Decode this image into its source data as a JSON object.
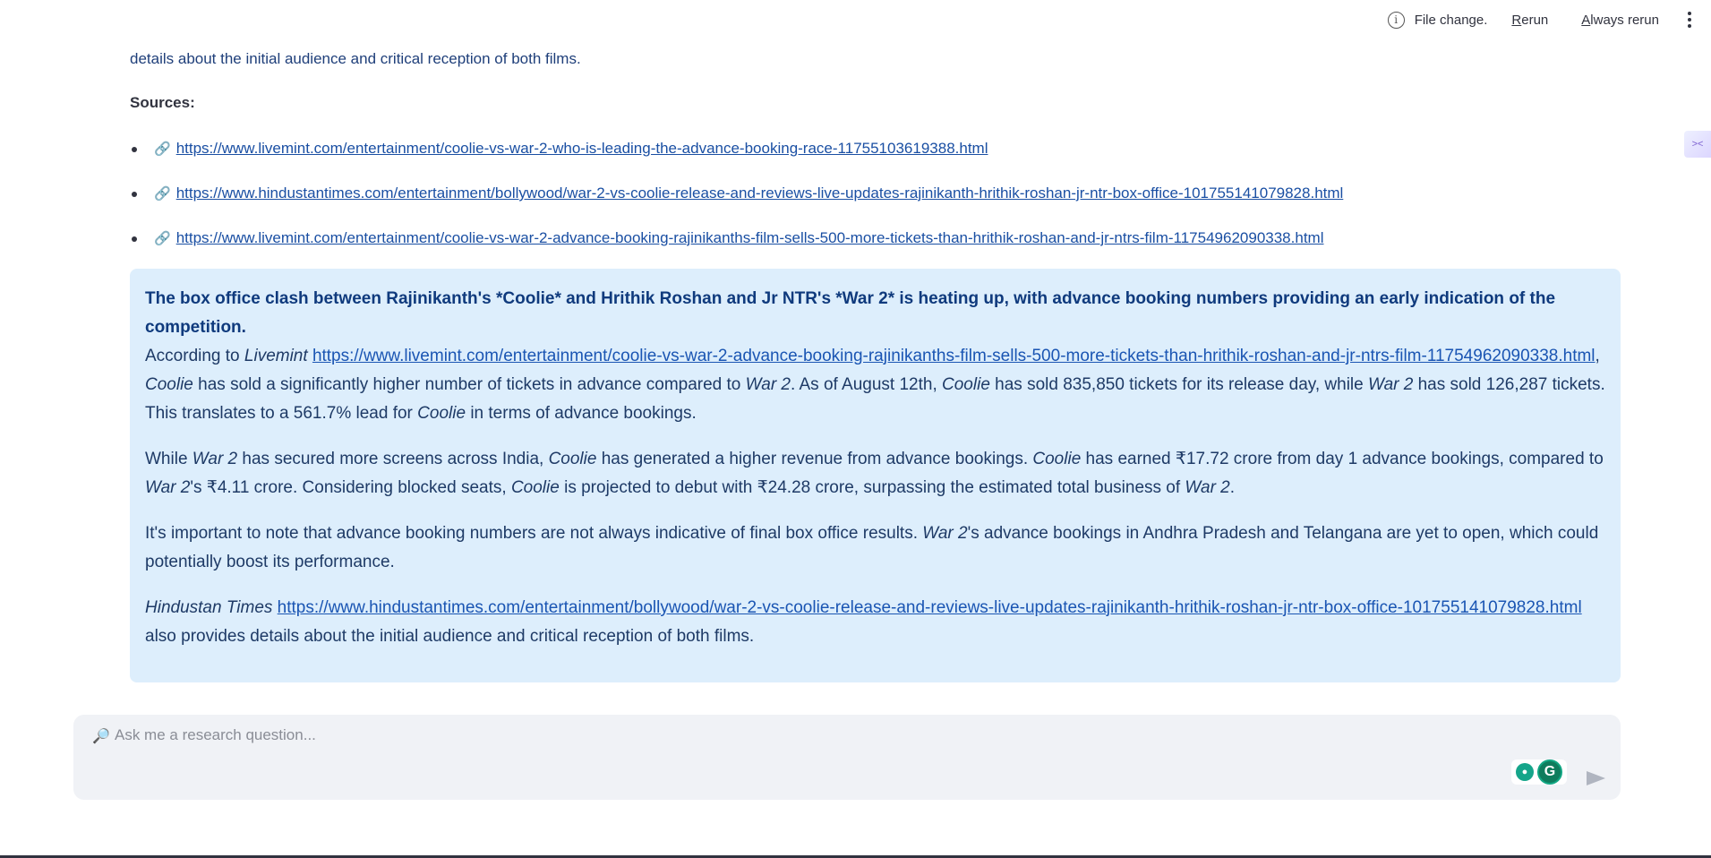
{
  "toolbar": {
    "status": "File change.",
    "rerun_label_prefix": "R",
    "rerun_label_rest": "erun",
    "always_rerun_label_prefix": "A",
    "always_rerun_label_rest": "lways rerun"
  },
  "content": {
    "top_line": "details about the initial audience and critical reception of both films.",
    "sources_label": "Sources:",
    "sources": [
      "https://www.livemint.com/entertainment/coolie-vs-war-2-who-is-leading-the-advance-booking-race-11755103619388.html",
      "https://www.hindustantimes.com/entertainment/bollywood/war-2-vs-coolie-release-and-reviews-live-updates-rajinikanth-hrithik-roshan-jr-ntr-box-office-101755141079828.html",
      "https://www.livemint.com/entertainment/coolie-vs-war-2-advance-booking-rajinikanths-film-sells-500-more-tickets-than-hrithik-roshan-and-jr-ntrs-film-11754962090338.html"
    ]
  },
  "answer": {
    "headline": "The box office clash between Rajinikanth's *Coolie* and Hrithik Roshan and Jr NTR's *War 2* is heating up, with advance booking numbers providing an early indication of the competition.",
    "p1": {
      "t1": "According to ",
      "e1": "Livemint",
      "t2": " ",
      "link": "https://www.livemint.com/entertainment/coolie-vs-war-2-advance-booking-rajinikanths-film-sells-500-more-tickets-than-hrithik-roshan-and-jr-ntrs-film-11754962090338.html",
      "t3": ", ",
      "e2": "Coolie",
      "t4": " has sold a significantly higher number of tickets in advance compared to ",
      "e3": "War 2",
      "t5": ". As of August 12th, ",
      "e4": "Coolie",
      "t6": " has sold 835,850 tickets for its release day, while ",
      "e5": "War 2",
      "t7": " has sold 126,287 tickets. This translates to a 561.7% lead for ",
      "e6": "Coolie",
      "t8": " in terms of advance bookings."
    },
    "p2": {
      "t1": "While ",
      "e1": "War 2",
      "t2": " has secured more screens across India, ",
      "e2": "Coolie",
      "t3": " has generated a higher revenue from advance bookings. ",
      "e3": "Coolie",
      "t4": " has earned ₹17.72 crore from day 1 advance bookings, compared to ",
      "e4": "War 2",
      "t5": "'s ₹4.11 crore. Considering blocked seats, ",
      "e5": "Coolie",
      "t6": " is projected to debut with ₹24.28 crore, surpassing the estimated total business of ",
      "e6": "War 2",
      "t7": "."
    },
    "p3": {
      "t1": "It's important to note that advance booking numbers are not always indicative of final box office results. ",
      "e1": "War 2",
      "t2": "'s advance bookings in Andhra Pradesh and Telangana are yet to open, which could potentially boost its performance."
    },
    "p4": {
      "e1": "Hindustan Times",
      "t1": " ",
      "link": "https://www.hindustantimes.com/entertainment/bollywood/war-2-vs-coolie-release-and-reviews-live-updates-rajinikanth-hrithik-roshan-jr-ntr-box-office-101755141079828.html",
      "t2": " also provides details about the initial audience and critical reception of both films."
    }
  },
  "chat": {
    "placeholder": "Ask me a research question..."
  },
  "icons": {
    "info": "info-icon",
    "kebab": "more-vertical-icon",
    "link": "link-icon",
    "search": "magnifier-icon",
    "bulb": "lightbulb-icon",
    "grammarly": "grammarly-icon",
    "send": "send-icon"
  }
}
